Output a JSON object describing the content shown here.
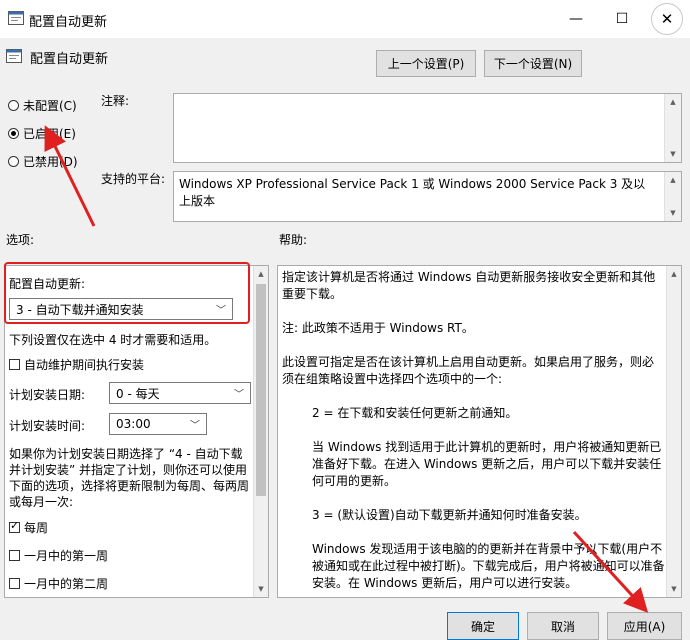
{
  "window": {
    "title": "配置自动更新",
    "minimize": "—",
    "maximize": "☐",
    "close": "✕"
  },
  "header": {
    "policy_name": "配置自动更新",
    "prev_button": "上一个设置(P)",
    "next_button": "下一个设置(N)"
  },
  "state_options": [
    {
      "label": "未配置(C)",
      "selected": false
    },
    {
      "label": "已启用(E)",
      "selected": true
    },
    {
      "label": "已禁用(D)",
      "selected": false
    }
  ],
  "comment": {
    "label": "注释:",
    "value": ""
  },
  "platform": {
    "label": "支持的平台:",
    "value": "Windows XP Professional Service Pack 1 或 Windows 2000 Service Pack 3 及以上版本"
  },
  "options": {
    "section_label": "选项:",
    "config_label": "配置自动更新:",
    "config_value": "3 - 自动下载并通知安装",
    "note": "下列设置仅在选中 4 时才需要和适用。",
    "maintenance_checkbox": "自动维护期间执行安装",
    "maintenance_checked": false,
    "day_label": "计划安装日期:",
    "day_value": "0 - 每天",
    "time_label": "计划安装时间:",
    "time_value": "03:00",
    "paragraph": "如果你为计划安装日期选择了 “4 - 自动下载并计划安装” 并指定了计划，则你还可以使用下面的选项，选择将更新限制为每周、每两周或每月一次:",
    "weekly": "每周",
    "weekly_checked": true,
    "first_week": "一月中的第一周",
    "first_week_checked": false,
    "second_week": "一月中的第二周",
    "second_week_checked": false
  },
  "help": {
    "section_label": "帮助:",
    "paragraphs": [
      "指定该计算机是否将通过 Windows 自动更新服务接收安全更新和其他重要下载。",
      "注: 此政策不适用于 Windows RT。",
      "此设置可指定是否在该计算机上启用自动更新。如果启用了服务，则必须在组策略设置中选择四个选项中的一个:",
      "2 = 在下载和安装任何更新之前通知。",
      "当 Windows 找到适用于此计算机的更新时，用户将被通知更新已准备好下载。在进入 Windows 更新之后，用户可以下载并安装任何可用的更新。",
      "3 = (默认设置)自动下载更新并通知何时准备安装。",
      "Windows 发现适用于该电脑的的更新并在背景中予以下载(用户不被通知或在此过程中被打断)。下载完成后，用户将被通知可以准备安装。在 Windows 更新后，用户可以进行安装。"
    ]
  },
  "footer": {
    "ok": "确定",
    "cancel": "取消",
    "apply": "应用(A)"
  },
  "colors": {
    "annotation_red": "#e02020",
    "dialog_bg": "#f0f0f0",
    "default_button_border": "#0078d7"
  }
}
